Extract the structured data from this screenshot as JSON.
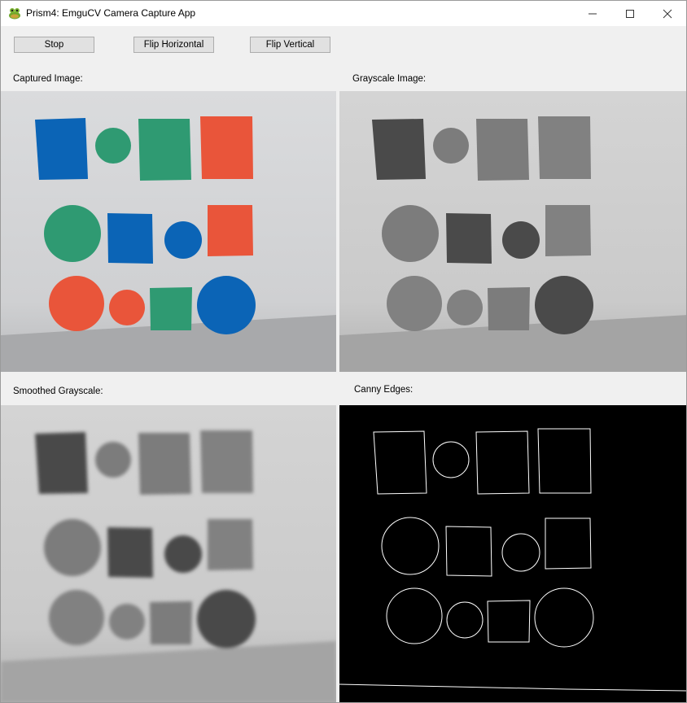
{
  "window": {
    "title": "Prism4: EmguCV Camera Capture App",
    "controls": [
      "minimize-icon",
      "maximize-icon",
      "close-icon"
    ]
  },
  "toolbar": {
    "stop_label": "Stop",
    "flip_horizontal_label": "Flip Horizontal",
    "flip_vertical_label": "Flip Vertical"
  },
  "panels": {
    "captured_label": "Captured Image:",
    "grayscale_label": "Grayscale Image:",
    "smoothed_label": "Smoothed Grayscale:",
    "canny_label": "Canny Edges:"
  },
  "colors": {
    "blue": "#0b64b6",
    "green": "#2f9a72",
    "red": "#e9553a",
    "paper": "#d4d5d7",
    "canny_background": "#000000",
    "canny_edge": "#ffffff"
  },
  "icons": {
    "app": "frog-icon"
  }
}
